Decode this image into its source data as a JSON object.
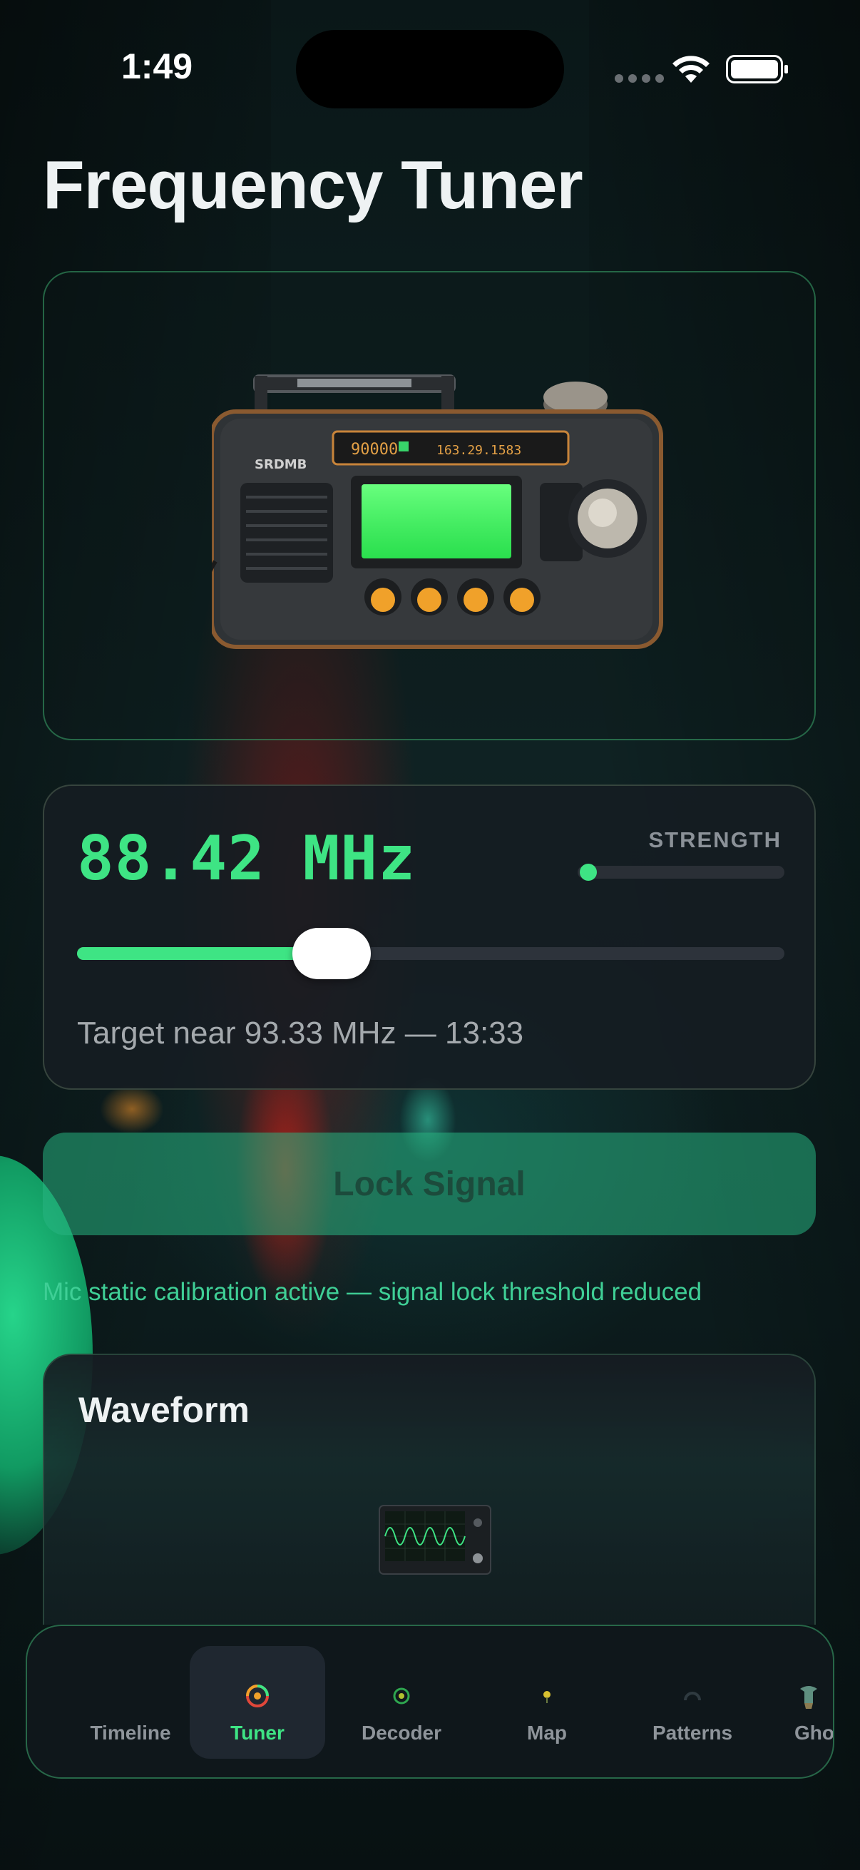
{
  "status_bar": {
    "time": "1:49"
  },
  "page": {
    "title": "Frequency Tuner"
  },
  "tuner": {
    "frequency": "88.42 MHz",
    "strength_label": "STRENGTH",
    "strength_level": 0.05,
    "slider_level": 0.36,
    "target_text": "Target near 93.33 MHz — 13:33"
  },
  "lock_button": {
    "label": "Lock Signal"
  },
  "calibration_note": "Mic static calibration active — signal lock threshold reduced",
  "waveform": {
    "title": "Waveform"
  },
  "tab_bar": {
    "active": "Tuner",
    "tabs": [
      {
        "label": "Timeline",
        "icon": "timeline-icon"
      },
      {
        "label": "Tuner",
        "icon": "tuner-dial-icon"
      },
      {
        "label": "Decoder",
        "icon": "decoder-icon"
      },
      {
        "label": "Map",
        "icon": "map-pin-icon"
      },
      {
        "label": "Patterns",
        "icon": "patterns-icon"
      },
      {
        "label": "Ghos",
        "icon": "ghost-icon"
      }
    ]
  },
  "colors": {
    "accent": "#3ee484",
    "lock_button": "#28b482",
    "note": "#3fcf96"
  }
}
